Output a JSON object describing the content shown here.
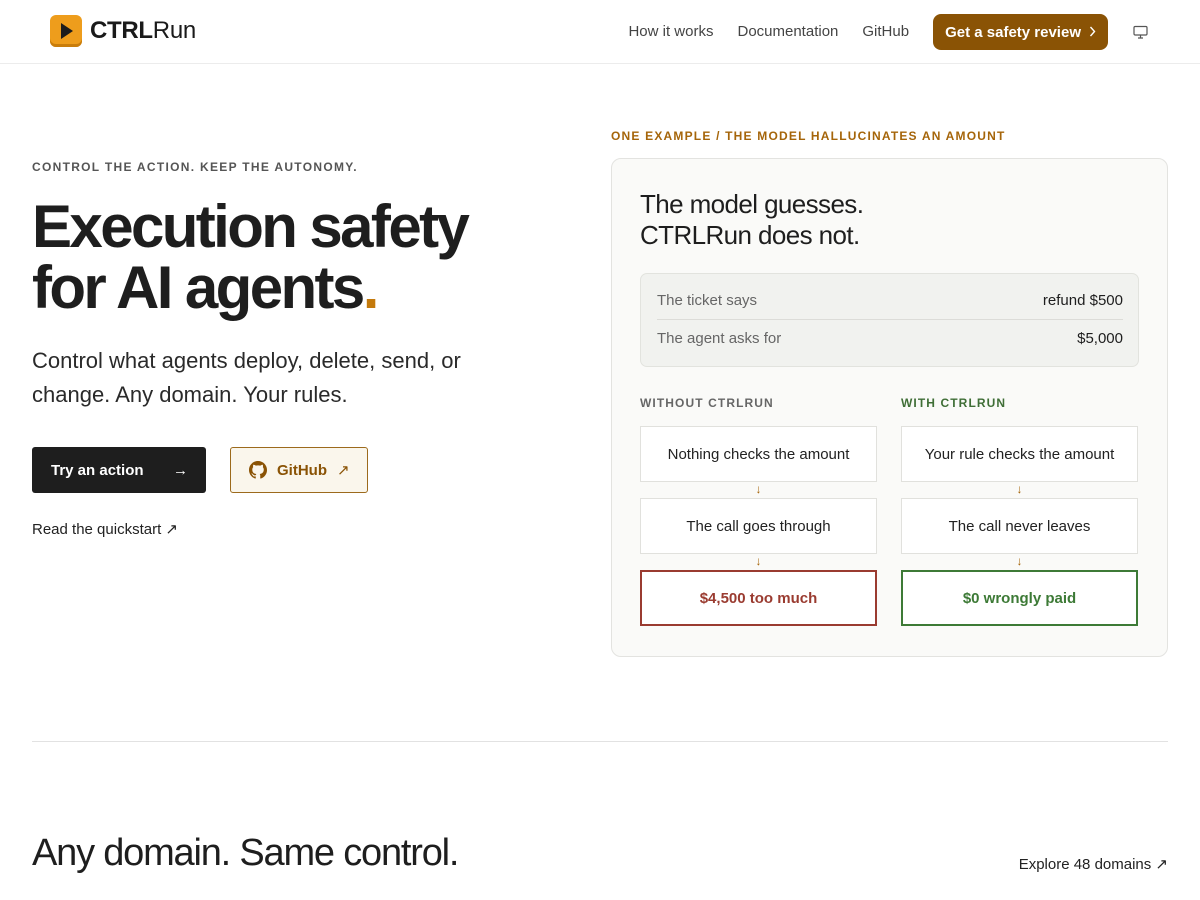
{
  "header": {
    "brand_bold": "CTRL",
    "brand_light": "Run",
    "nav": [
      "How it works",
      "Documentation",
      "GitHub"
    ],
    "cta_label": "Get a safety review",
    "icons": {
      "logo": "play-icon",
      "theme": "monitor-icon",
      "chevron": "chevron-right-icon"
    }
  },
  "hero": {
    "eyebrow": "CONTROL THE ACTION. KEEP THE AUTONOMY.",
    "title_line1": "Execution safety",
    "title_line2": "for AI agents",
    "title_dot": ".",
    "subtitle": "Control what agents deploy, delete, send, or change. Any domain. Your rules.",
    "primary_label": "Try an action",
    "primary_arrow": "→",
    "secondary_label": "GitHub",
    "secondary_ext": "↗",
    "quickstart": "Read the quickstart ↗"
  },
  "example": {
    "eyebrow": "ONE EXAMPLE / THE MODEL HALLUCINATES AN AMOUNT",
    "title_line1": "The model guesses.",
    "title_line2": "CTRLRun does not.",
    "ticket": [
      {
        "label": "The ticket says",
        "value": "refund $500"
      },
      {
        "label": "The agent asks for",
        "value": "$5,000"
      }
    ],
    "without": {
      "heading": "WITHOUT CTRLRUN",
      "steps": [
        "Nothing checks the amount",
        "The call goes through",
        "$4,500 too much"
      ]
    },
    "with": {
      "heading": "WITH CTRLRUN",
      "steps": [
        "Your rule checks the amount",
        "The call never leaves",
        "$0 wrongly paid"
      ]
    },
    "arrow": "↓"
  },
  "domains": {
    "title": "Any domain. Same control.",
    "explore": "Explore 48 domains ↗"
  },
  "colors": {
    "accent": "#8a5305",
    "accent_light": "#c47a0c",
    "danger": "#9a3b30",
    "success": "#3d7a36"
  }
}
